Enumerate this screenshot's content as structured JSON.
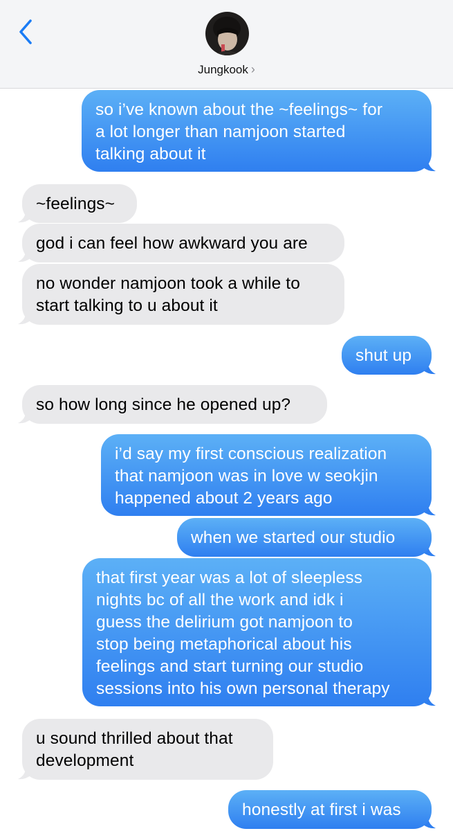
{
  "header": {
    "contact_name": "Jungkook",
    "chevron": "›",
    "back_icon": "chevron-left-icon"
  },
  "colors": {
    "sent_top": "#5cb0f6",
    "sent_bottom": "#2f7ff0",
    "received": "#e9e9eb",
    "accent": "#1a7cf5"
  },
  "messages": [
    {
      "from": "me",
      "lines": [
        "so i’ve known about the ~feelings~ for",
        "a lot longer than namjoon started",
        "talking about it"
      ]
    },
    {
      "from": "them",
      "lines": [
        "~feelings~"
      ]
    },
    {
      "from": "them",
      "lines": [
        "god i can feel how awkward you are"
      ]
    },
    {
      "from": "them",
      "lines": [
        "no wonder namjoon took a while to",
        "start talking to u about it"
      ]
    },
    {
      "from": "me",
      "lines": [
        "shut up"
      ]
    },
    {
      "from": "them",
      "lines": [
        "so how long since he opened up?"
      ]
    },
    {
      "from": "me",
      "lines": [
        "i’d say my first conscious realization",
        "that namjoon was in love w seokjin",
        "happened about 2 years ago"
      ]
    },
    {
      "from": "me",
      "lines": [
        "when we started our studio"
      ]
    },
    {
      "from": "me",
      "lines": [
        "that first year was a lot of sleepless",
        "nights bc of all the work and idk i",
        "guess the delirium got namjoon to",
        "stop being metaphorical about his",
        "feelings and start turning our studio",
        "sessions into his own personal therapy"
      ]
    },
    {
      "from": "them",
      "lines": [
        "u sound thrilled about that",
        "development"
      ]
    },
    {
      "from": "me",
      "lines": [
        "honestly at first i was"
      ]
    }
  ]
}
